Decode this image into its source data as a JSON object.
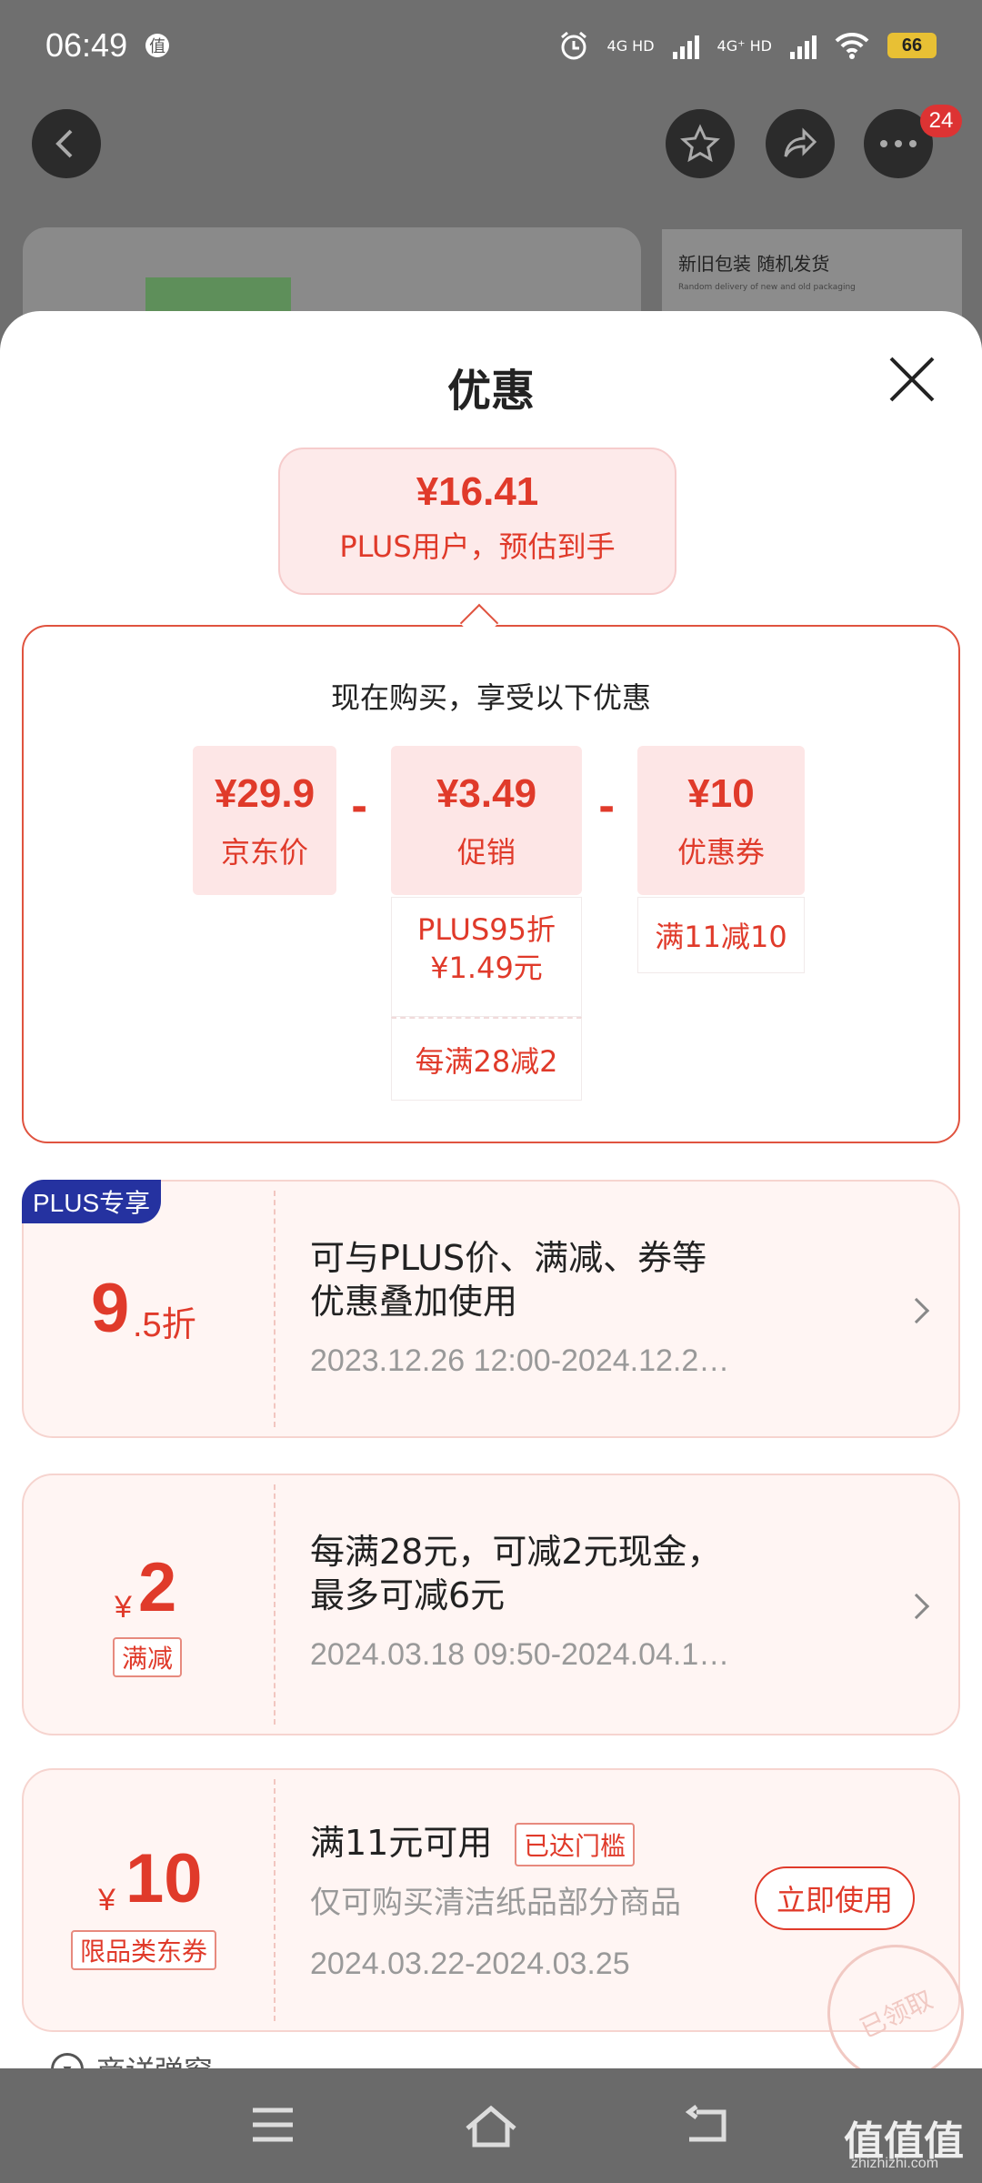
{
  "status_bar": {
    "time": "06:49",
    "app_icon": "值",
    "net1": "4G HD",
    "net2": "4G⁺ HD",
    "battery": "66"
  },
  "background": {
    "notification_count": "24",
    "banner_title": "新旧包装 随机发货",
    "banner_sub": "Random delivery of new and old packaging"
  },
  "sheet": {
    "title": "优惠",
    "estimate": {
      "price": "¥16.41",
      "label": "PLUS用户，预估到手"
    },
    "now_buy_text": "现在购买，享受以下优惠",
    "breakdown": {
      "jd_price": {
        "value": "¥29.9",
        "label": "京东价"
      },
      "promo": {
        "value": "¥3.49",
        "label": "促销"
      },
      "coupon": {
        "value": "¥10",
        "label": "优惠券"
      },
      "minus": "-",
      "promo_details": [
        "PLUS95折\n¥1.49元",
        "每满28减2"
      ],
      "coupon_details": [
        "满11减10"
      ]
    },
    "cards": [
      {
        "tag": "PLUS专享",
        "big": "9",
        "small": ".5折",
        "title": "可与PLUS价、满减、券等\n优惠叠加使用",
        "date": "2023.12.26 12:00-2024.12.2…"
      },
      {
        "currency": "¥",
        "big": "2",
        "type_tag": "满减",
        "title": "每满28元，可减2元现金，\n最多可减6元",
        "date": "2024.03.18 09:50-2024.04.1…"
      },
      {
        "currency": "¥",
        "big": "10",
        "type_tag": "限品类东券",
        "title": "满11元可用",
        "reached": "已达门槛",
        "desc": "仅可购买清洁纸品部分商品",
        "date": "2024.03.22-2024.03.25",
        "button": "立即使用",
        "stamp": "已领取"
      }
    ],
    "peek_text": "商详弹窗"
  },
  "watermark": {
    "main": "值值值",
    "sub": "zhizhizhi.com"
  }
}
